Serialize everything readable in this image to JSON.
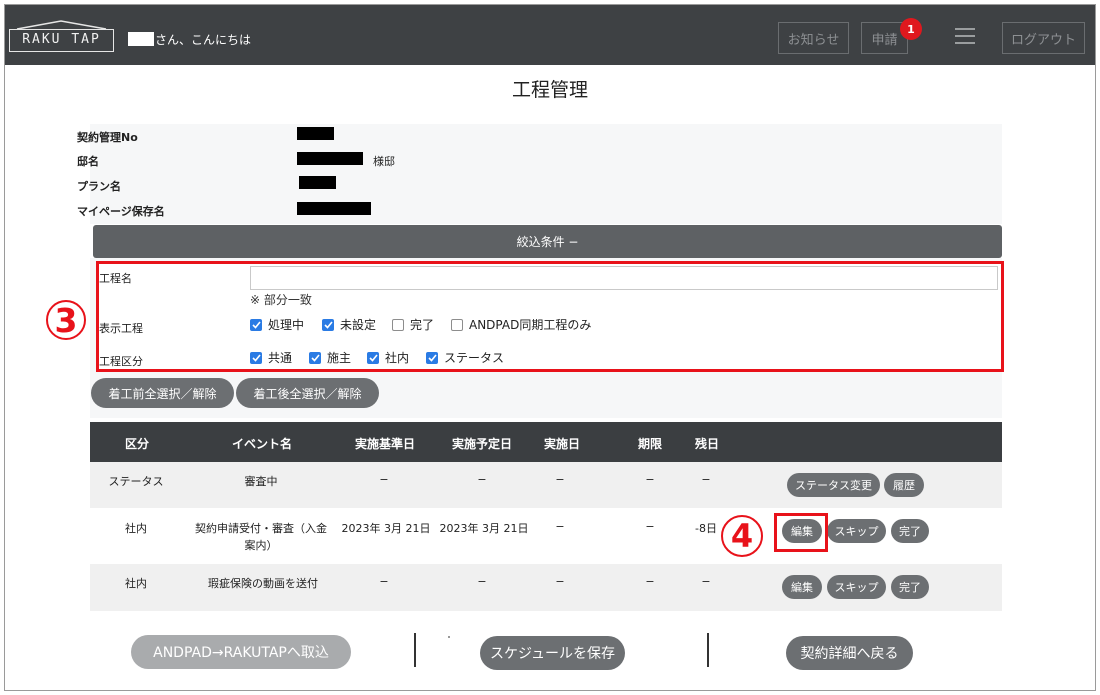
{
  "header": {
    "logo_text": "RAKU TAP",
    "greeting": "さん、こんにちは",
    "news_label": "お知らせ",
    "apply_label": "申請",
    "apply_badge": "1",
    "logout_label": "ログアウト"
  },
  "page": {
    "title": "工程管理"
  },
  "info": {
    "contract_no_label": "契約管理No",
    "house_label": "邸名",
    "house_suffix": "様邸",
    "plan_label": "プラン名",
    "mypage_label": "マイページ保存名"
  },
  "filter": {
    "header_label": "絞込条件 −",
    "process_name_label": "工程名",
    "process_name_value": "",
    "match_note": "※ 部分一致",
    "display_label": "表示工程",
    "display_options": [
      {
        "label": "処理中",
        "checked": true
      },
      {
        "label": "未設定",
        "checked": true
      },
      {
        "label": "完了",
        "checked": false
      },
      {
        "label": "ANDPAD同期工程のみ",
        "checked": false
      }
    ],
    "category_label": "工程区分",
    "category_options": [
      {
        "label": "共通",
        "checked": true
      },
      {
        "label": "施主",
        "checked": true
      },
      {
        "label": "社内",
        "checked": true
      },
      {
        "label": "ステータス",
        "checked": true
      }
    ],
    "pre_select_label": "着工前全選択／解除",
    "post_select_label": "着工後全選択／解除"
  },
  "annotations": {
    "marker_3": "3",
    "marker_4": "4"
  },
  "table": {
    "headers": [
      "区分",
      "イベント名",
      "実施基準日",
      "実施予定日",
      "実施日",
      "期限",
      "残日"
    ],
    "rows": [
      {
        "category": "ステータス",
        "event": "審査中",
        "base_date": "−",
        "plan_date": "−",
        "done_date": "−",
        "deadline": "−",
        "remaining": "−",
        "buttons": [
          "ステータス変更",
          "履歴"
        ]
      },
      {
        "category": "社内",
        "event_line1": "契約申請受付・審査（入金",
        "event_line2": "案内）",
        "base_date": "2023年 3月 21日",
        "plan_date": "2023年 3月 21日",
        "done_date": "−",
        "deadline": "−",
        "remaining": "-8日",
        "buttons": [
          "編集",
          "スキップ",
          "完了"
        ]
      },
      {
        "category": "社内",
        "event": "瑕疵保険の動画を送付",
        "base_date": "−",
        "plan_date": "−",
        "done_date": "−",
        "deadline": "−",
        "remaining": "−",
        "buttons": [
          "編集",
          "スキップ",
          "完了"
        ]
      }
    ]
  },
  "footer": {
    "import_label": "ANDPAD→RAKUTAPへ取込",
    "save_label": "スケジュールを保存",
    "back_label": "契約詳細へ戻る"
  },
  "colors": {
    "header_bg": "#3e4144",
    "button_gray": "#6c6f72",
    "accent_red": "#e8121a",
    "checkbox_blue": "#2a7be4",
    "disabled_button": "#a9abad"
  }
}
